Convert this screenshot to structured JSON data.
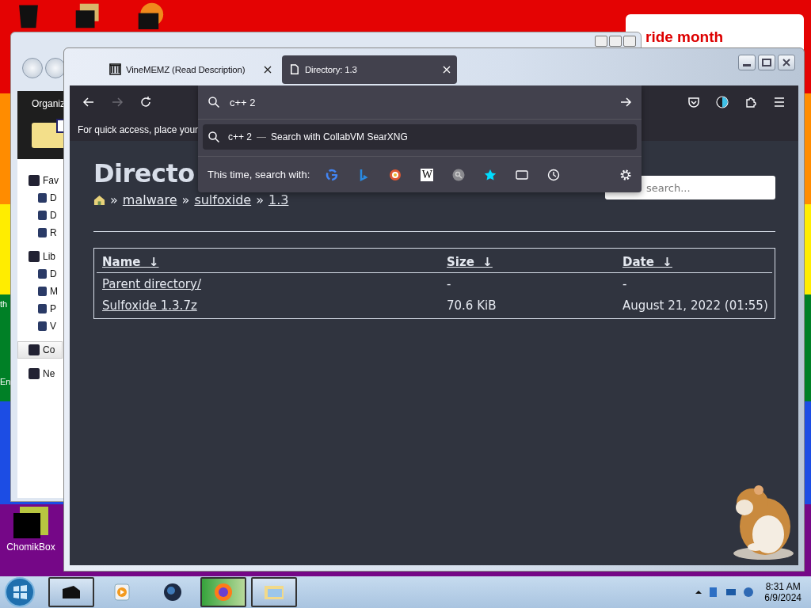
{
  "desktop": {
    "banner_text": "ride month",
    "edge_texts": [
      "th",
      "En"
    ],
    "icons": [
      {
        "label": "ChomikBox"
      }
    ]
  },
  "explorer": {
    "toolbar_text": "Organiz",
    "sidebar": [
      {
        "label": "Fav",
        "selected": false,
        "children": [
          {
            "label": "D",
            "selected": false
          },
          {
            "label": "D",
            "selected": false
          },
          {
            "label": "R",
            "selected": false
          }
        ]
      },
      {
        "label": "Lib",
        "selected": false,
        "children": [
          {
            "label": "D",
            "selected": false
          },
          {
            "label": "M",
            "selected": false
          },
          {
            "label": "P",
            "selected": false
          },
          {
            "label": "V",
            "selected": false
          }
        ]
      },
      {
        "label": "Co",
        "selected": true
      },
      {
        "label": "Ne",
        "selected": false
      }
    ]
  },
  "browser": {
    "tabs": [
      {
        "title": "VineMEMZ (Read Description)",
        "selected": false
      },
      {
        "title": "Directory: 1.3",
        "selected": true
      }
    ],
    "forward_disabled": true,
    "bookmarks_hint": "For quick access, place your",
    "urlbar": {
      "value": "c++ 2"
    },
    "suggestion": {
      "query": "c++ 2",
      "separator": "—",
      "action": "Search with CollabVM SearXNG"
    },
    "search_with_label": "This time, search with:",
    "wiki_glyph": "W",
    "page": {
      "heading": "Directo",
      "breadcrumb_separator": "»",
      "breadcrumbs": [
        "malware",
        "sulfoxide",
        "1.3"
      ],
      "search_placeholder": "search...",
      "table": {
        "columns": [
          {
            "label": "Name",
            "arrow": "↓"
          },
          {
            "label": "Size",
            "arrow": "↓"
          },
          {
            "label": "Date",
            "arrow": "↓"
          }
        ],
        "rows": [
          [
            "Parent directory/",
            "-",
            "-"
          ],
          [
            "Sulfoxide 1.3.7z",
            "70.6 KiB",
            "August 21, 2022 (01:55)"
          ]
        ]
      }
    }
  },
  "taskbar": {
    "time": "8:31 AM",
    "date": "6/9/2024"
  }
}
